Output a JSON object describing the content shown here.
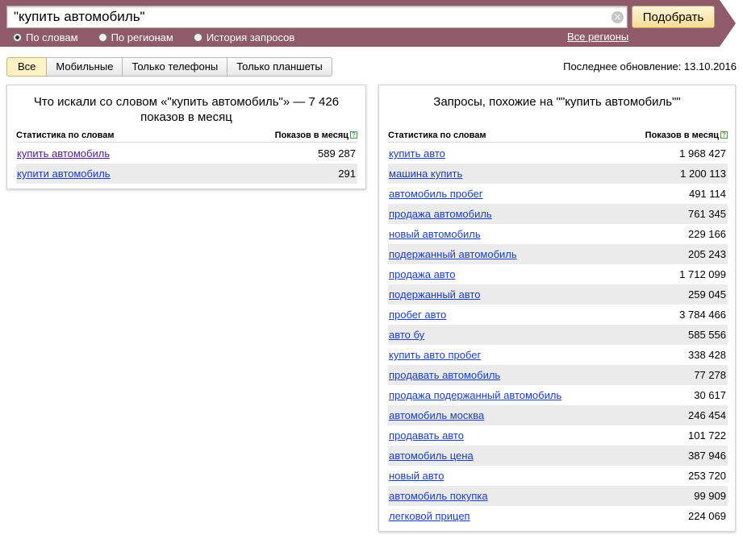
{
  "search": {
    "query": "\"купить автомобиль\"",
    "clear_icon": "×",
    "submit_label": "Подобрать",
    "modes": [
      {
        "label": "По словам",
        "checked": true
      },
      {
        "label": "По регионам",
        "checked": false
      },
      {
        "label": "История запросов",
        "checked": false
      }
    ],
    "regions_link": "Все регионы"
  },
  "tabs": [
    {
      "label": "Все",
      "active": true
    },
    {
      "label": "Мобильные",
      "active": false
    },
    {
      "label": "Только телефоны",
      "active": false
    },
    {
      "label": "Только планшеты",
      "active": false
    }
  ],
  "last_update": "Последнее обновление: 13.10.2016",
  "left_panel": {
    "title": "Что искали со словом «\"купить автомобиль\"» — 7 426 показов в месяц",
    "col_phrase": "Статистика по словам",
    "col_count": "Показов в месяц",
    "help_icon": "?",
    "rows": [
      {
        "phrase": "купить автомобиль",
        "count": "589 287",
        "visited": true
      },
      {
        "phrase": "купити автомобиль",
        "count": "291",
        "visited": false
      }
    ]
  },
  "right_panel": {
    "title": "Запросы, похожие на \"\"купить автомобиль\"\"",
    "col_phrase": "Статистика по словам",
    "col_count": "Показов в месяц",
    "help_icon": "?",
    "rows": [
      {
        "phrase": "купить авто",
        "count": "1 968 427"
      },
      {
        "phrase": "машина купить",
        "count": "1 200 113"
      },
      {
        "phrase": "автомобиль пробег",
        "count": "491 114"
      },
      {
        "phrase": "продажа автомобиль",
        "count": "761 345"
      },
      {
        "phrase": "новый автомобиль",
        "count": "229 166"
      },
      {
        "phrase": "подержанный автомобиль",
        "count": "205 243"
      },
      {
        "phrase": "продажа авто",
        "count": "1 712 099"
      },
      {
        "phrase": "подержанный авто",
        "count": "259 045"
      },
      {
        "phrase": "пробег авто",
        "count": "3 784 466"
      },
      {
        "phrase": "авто бу",
        "count": "585 556"
      },
      {
        "phrase": "купить авто пробег",
        "count": "338 428"
      },
      {
        "phrase": "продавать автомобиль",
        "count": "77 278"
      },
      {
        "phrase": "продажа подержанный автомобиль",
        "count": "30 617"
      },
      {
        "phrase": "автомобиль москва",
        "count": "246 454"
      },
      {
        "phrase": "продавать авто",
        "count": "101 722"
      },
      {
        "phrase": "автомобиль цена",
        "count": "387 946"
      },
      {
        "phrase": "новый авто",
        "count": "253 720"
      },
      {
        "phrase": "автомобиль покупка",
        "count": "99 909"
      },
      {
        "phrase": "легковой прицеп",
        "count": "224 069"
      }
    ]
  },
  "colors": {
    "header_band": "#8f5b6b",
    "link": "#1a3dc1",
    "visited_link": "#551a8b",
    "active_tab": "#fdf1c6",
    "button": "#f6dd92"
  }
}
